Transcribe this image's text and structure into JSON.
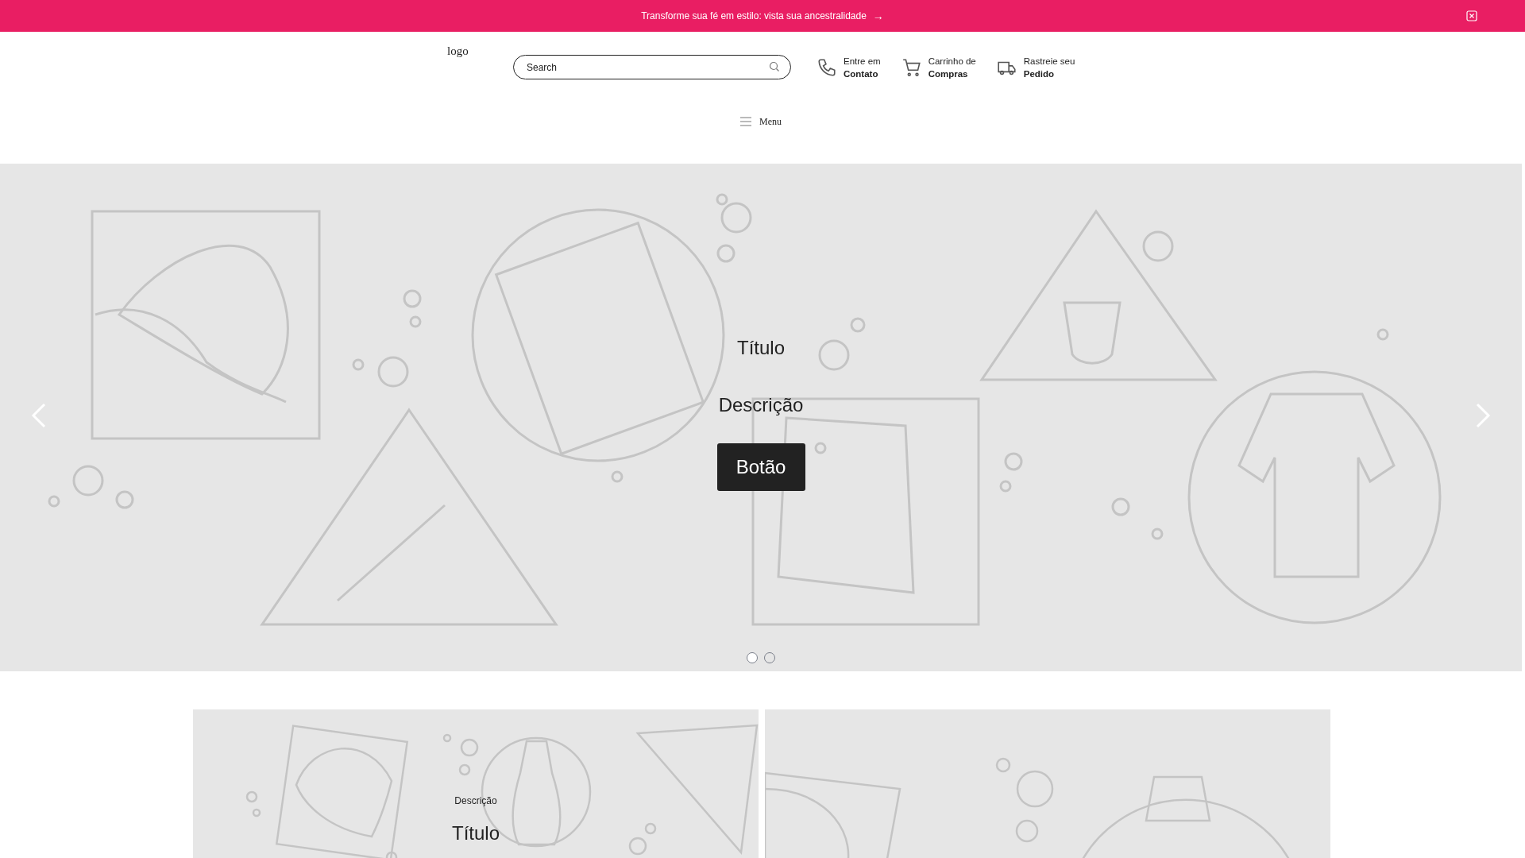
{
  "announcement": {
    "text": "Transforme sua fé em estilo: vista sua ancestralidade",
    "arrow": "→"
  },
  "header": {
    "logo_alt": "logo",
    "search": {
      "placeholder": "Search"
    },
    "links": [
      {
        "kind": "phone",
        "line1": "Entre em",
        "line2": "Contato"
      },
      {
        "kind": "cart",
        "line1": "Carrinho de",
        "line2": "Compras"
      },
      {
        "kind": "truck",
        "line1": "Rastreie seu",
        "line2": "Pedido"
      }
    ],
    "menu": {
      "label": "Menu"
    }
  },
  "hero": {
    "title": "Título",
    "description": "Descrição",
    "button": "Botão",
    "slides": [
      {
        "selected": true
      },
      {
        "selected": false
      }
    ]
  },
  "banners": [
    {
      "kind": "text",
      "description": "Descrição",
      "title": "Título"
    },
    {
      "kind": "plain"
    }
  ]
}
